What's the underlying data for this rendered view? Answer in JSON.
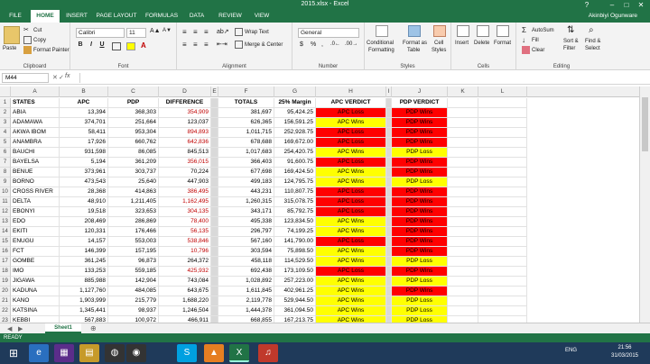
{
  "window": {
    "title": "2015.xlsx - Excel",
    "help": "?",
    "minimize": "–",
    "restore": "□",
    "close": "✕"
  },
  "tabs": [
    "FILE",
    "HOME",
    "INSERT",
    "PAGE LAYOUT",
    "FORMULAS",
    "DATA",
    "REVIEW",
    "VIEW"
  ],
  "active_tab": "HOME",
  "user": "Akinbiyi Ogunware",
  "ribbon": {
    "clipboard": {
      "label": "Clipboard",
      "paste": "Paste",
      "cut": "Cut",
      "copy": "Copy",
      "format_painter": "Format Painter"
    },
    "font": {
      "label": "Font",
      "family": "Calibri",
      "size": "11",
      "bold": "B",
      "italic": "I",
      "underline": "U"
    },
    "alignment": {
      "label": "Alignment",
      "wrap": "Wrap Text",
      "merge": "Merge & Center"
    },
    "number": {
      "label": "Number",
      "format": "General",
      "currency": "$",
      "percent": "%"
    },
    "styles": {
      "label": "Styles",
      "conditional": "Conditional",
      "conditional2": "Formatting",
      "format_as": "Format as",
      "format_as2": "Table",
      "cell": "Cell",
      "cell2": "Styles"
    },
    "cells": {
      "label": "Cells",
      "insert": "Insert",
      "delete": "Delete",
      "format": "Format"
    },
    "editing": {
      "label": "Editing",
      "autosum": "AutoSum",
      "fill": "Fill",
      "clear": "Clear",
      "sort": "Sort &",
      "sort2": "Filter",
      "find": "Find &",
      "find2": "Select"
    }
  },
  "formula_bar": {
    "name_box": "M44",
    "fx": "fx",
    "value": ""
  },
  "columns": [
    "A",
    "B",
    "C",
    "D",
    "E",
    "F",
    "G",
    "H",
    "I",
    "J",
    "K",
    "L"
  ],
  "headers": [
    "STATES",
    "APC",
    "PDP",
    "DIFFERENCE",
    "TOTALS",
    "25% Margin",
    "APC VERDICT",
    "PDP VERDICT"
  ],
  "rows": [
    [
      "ABIA",
      "13,394",
      "368,303",
      "354,909",
      "381,697",
      "95,424.25",
      "APC Loss",
      "PDP Wins"
    ],
    [
      "ADAMAWA",
      "374,701",
      "251,664",
      "123,037",
      "626,365",
      "156,591.25",
      "APC Wins",
      "PDP Wins"
    ],
    [
      "AKWA IBOM",
      "58,411",
      "953,304",
      "894,893",
      "1,011,715",
      "252,928.75",
      "APC Loss",
      "PDP Wins"
    ],
    [
      "ANAMBRA",
      "17,926",
      "660,762",
      "642,836",
      "678,688",
      "169,672.00",
      "APC Loss",
      "PDP Wins"
    ],
    [
      "BAUCHI",
      "931,598",
      "86,085",
      "845,513",
      "1,017,683",
      "254,420.75",
      "APC Wins",
      "PDP Loss"
    ],
    [
      "BAYELSA",
      "5,194",
      "361,209",
      "356,015",
      "366,403",
      "91,600.75",
      "APC Loss",
      "PDP Wins"
    ],
    [
      "BENUE",
      "373,961",
      "303,737",
      "70,224",
      "677,698",
      "169,424.50",
      "APC Wins",
      "PDP Wins"
    ],
    [
      "BORNO",
      "473,543",
      "25,640",
      "447,903",
      "499,183",
      "124,795.75",
      "APC Wins",
      "PDP Loss"
    ],
    [
      "CROSS RIVER",
      "28,368",
      "414,863",
      "386,495",
      "443,231",
      "110,807.75",
      "APC Loss",
      "PDP Wins"
    ],
    [
      "DELTA",
      "48,910",
      "1,211,405",
      "1,162,495",
      "1,260,315",
      "315,078.75",
      "APC Loss",
      "PDP Wins"
    ],
    [
      "EBONYI",
      "19,518",
      "323,653",
      "304,135",
      "343,171",
      "85,792.75",
      "APC Loss",
      "PDP Wins"
    ],
    [
      "EDO",
      "208,469",
      "286,869",
      "78,400",
      "495,338",
      "123,834.50",
      "APC Wins",
      "PDP Wins"
    ],
    [
      "EKITI",
      "120,331",
      "176,466",
      "56,135",
      "296,797",
      "74,199.25",
      "APC Wins",
      "PDP Wins"
    ],
    [
      "ENUGU",
      "14,157",
      "553,003",
      "538,846",
      "567,160",
      "141,790.00",
      "APC Loss",
      "PDP Wins"
    ],
    [
      "FCT",
      "146,399",
      "157,195",
      "10,796",
      "303,594",
      "75,898.50",
      "APC Wins",
      "PDP Wins"
    ],
    [
      "GOMBE",
      "361,245",
      "96,873",
      "264,372",
      "458,118",
      "114,529.50",
      "APC Wins",
      "PDP Loss"
    ],
    [
      "IMO",
      "133,253",
      "559,185",
      "425,932",
      "692,438",
      "173,109.50",
      "APC Loss",
      "PDP Wins"
    ],
    [
      "JIGAWA",
      "885,988",
      "142,904",
      "743,084",
      "1,028,892",
      "257,223.00",
      "APC Wins",
      "PDP Loss"
    ],
    [
      "KADUNA",
      "1,127,760",
      "484,085",
      "643,675",
      "1,611,845",
      "402,961.25",
      "APC Wins",
      "PDP Wins"
    ],
    [
      "KANO",
      "1,903,999",
      "215,779",
      "1,688,220",
      "2,119,778",
      "529,944.50",
      "APC Wins",
      "PDP Loss"
    ],
    [
      "KATSINA",
      "1,345,441",
      "98,937",
      "1,246,504",
      "1,444,378",
      "361,094.50",
      "APC Wins",
      "PDP Loss"
    ],
    [
      "KEBBI",
      "567,883",
      "100,972",
      "466,911",
      "668,855",
      "167,213.75",
      "APC Wins",
      "PDP Loss"
    ]
  ],
  "sheet_tab": "Sheet1",
  "status": "READY",
  "clock": {
    "time": "21:56",
    "date": "31/03/2015",
    "lang": "ENG"
  },
  "colors": {
    "red": "#ff0000",
    "yellow": "#ffff00",
    "excel_green": "#217346"
  }
}
